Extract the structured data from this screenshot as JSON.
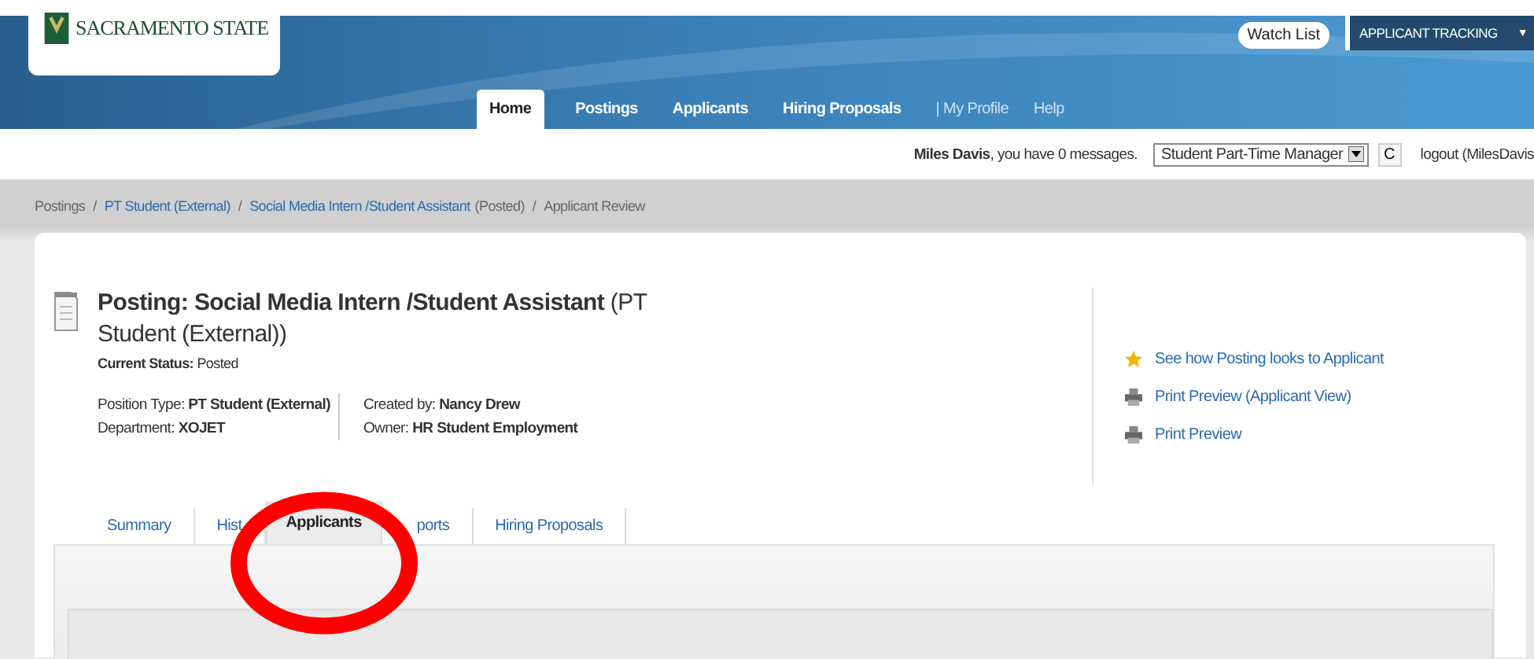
{
  "header": {
    "logo_text": "SACRAMENTO STATE",
    "watch_list": "Watch List",
    "module_menu": "APPLICANT TRACKING",
    "module_caret": "▼",
    "nav": [
      {
        "label": "Home",
        "selected": true
      },
      {
        "label": "Postings",
        "selected": false
      },
      {
        "label": "Applicants",
        "selected": false
      },
      {
        "label": "Hiring Proposals",
        "selected": false
      }
    ],
    "nav_links": [
      "| My Profile",
      "Help"
    ]
  },
  "user_bar": {
    "name": "Miles Davis",
    "messages": ", you have 0 messages.",
    "role": "Student Part-Time Manager",
    "refresh": "C",
    "logout": "logout (MilesDavis"
  },
  "breadcrumb": [
    {
      "text": "Postings",
      "kind": "plain",
      "sep": "/"
    },
    {
      "text": "PT Student (External)",
      "kind": "link",
      "sep": "/"
    },
    {
      "text": "Social Media Intern /Student Assistant",
      "kind": "link"
    },
    {
      "text": "(Posted)",
      "kind": "plain",
      "sep": "/"
    },
    {
      "text": "Applicant Review",
      "kind": "plain"
    }
  ],
  "posting": {
    "title": "Posting: Social Media Intern /Student Assistant",
    "title_suffix": "(PT Student (External))",
    "status_label": "Current Status:",
    "status": "Posted",
    "details_left": [
      {
        "label": "Position Type:",
        "value": "PT Student (External)"
      },
      {
        "label": "Department:",
        "value": "XOJET"
      }
    ],
    "details_right": [
      {
        "label": "Created by:",
        "value": "Nancy Drew"
      },
      {
        "label": "Owner:",
        "value": "HR Student Employment"
      }
    ]
  },
  "actions": [
    {
      "label": "See how Posting looks to Applicant",
      "kind": "star"
    },
    {
      "label": "Print Preview (Applicant View)",
      "kind": "printer"
    },
    {
      "label": "Print Preview",
      "kind": "printer"
    }
  ],
  "tabs": [
    {
      "label": "Summary",
      "selected": false
    },
    {
      "label": "Hist",
      "selected": false
    },
    {
      "label": "Applicants",
      "selected": true
    },
    {
      "label": "ports",
      "selected": false
    },
    {
      "label": "Hiring Proposals",
      "selected": false
    }
  ]
}
